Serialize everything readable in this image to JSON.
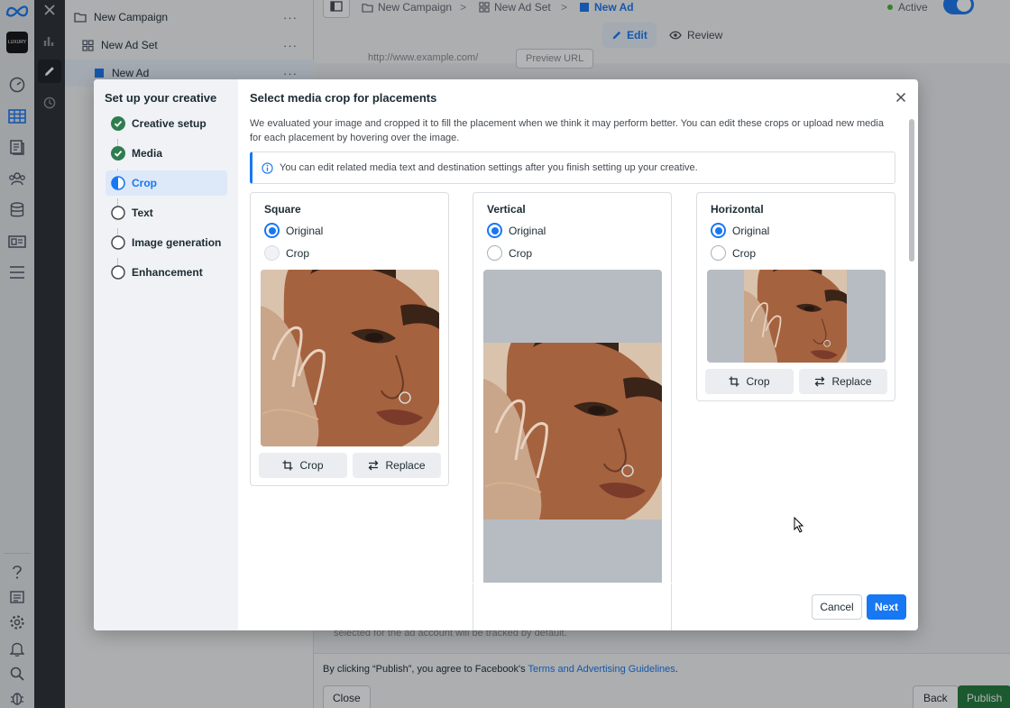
{
  "app": {
    "logo_text": "∞",
    "account_badge": "LUXURY"
  },
  "tree": {
    "campaign": "New Campaign",
    "ad_set": "New Ad Set",
    "ad": "New Ad",
    "more": "···"
  },
  "topbar": {
    "breadcrumbs": [
      "New Campaign",
      "New Ad Set",
      "New Ad"
    ],
    "separator": ">",
    "status": "Active",
    "edit_tab": "Edit",
    "review_tab": "Review"
  },
  "background": {
    "url_text": "http://www.example.com/",
    "preview_url": "Preview URL",
    "tracking_note": "selected for the ad account will be tracked by default.",
    "publish_notice": "By clicking “Publish”, you agree to Facebook's ",
    "publish_link": "Terms and Advertising Guidelines",
    "publish_period": ".",
    "close_button": "Close",
    "back_button": "Back",
    "publish_button": "Publish"
  },
  "modal": {
    "sidebar_title": "Set up your creative",
    "steps": [
      {
        "label": "Creative setup",
        "state": "done"
      },
      {
        "label": "Media",
        "state": "done"
      },
      {
        "label": "Crop",
        "state": "current"
      },
      {
        "label": "Text",
        "state": "todo"
      },
      {
        "label": "Image generation",
        "state": "todo"
      },
      {
        "label": "Enhancement",
        "state": "todo"
      }
    ],
    "title": "Select media crop for placements",
    "description": "We evaluated your image and cropped it to fill the placement when we think it may perform better. You can edit these crops or upload new media for each placement by hovering over the image.",
    "info": "You can edit related media text and destination settings after you finish setting up your creative.",
    "cards": [
      {
        "title": "Square",
        "option_original": "Original",
        "option_crop": "Crop",
        "selected": "Original",
        "crop_button": "Crop",
        "replace_button": "Replace"
      },
      {
        "title": "Vertical",
        "option_original": "Original",
        "option_crop": "Crop",
        "selected": "Original"
      },
      {
        "title": "Horizontal",
        "option_original": "Original",
        "option_crop": "Crop",
        "selected": "Original",
        "crop_button": "Crop",
        "replace_button": "Replace"
      }
    ],
    "cancel_button": "Cancel",
    "next_button": "Next"
  },
  "colors": {
    "accent": "#1877f2",
    "success": "#1f7a3a",
    "done_check": "#2e7d4f"
  }
}
